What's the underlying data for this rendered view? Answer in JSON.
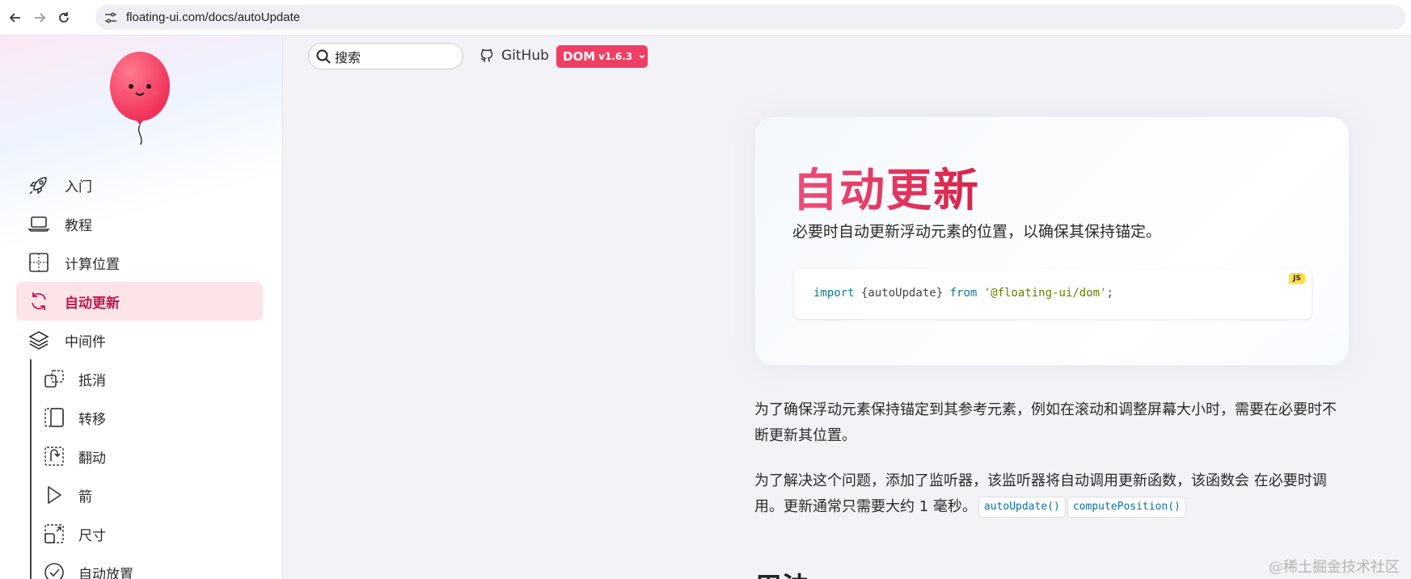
{
  "browser": {
    "url": "floating-ui.com/docs/autoUpdate"
  },
  "sidebar": {
    "items": [
      {
        "label": "入门",
        "icon": "rocket-icon"
      },
      {
        "label": "教程",
        "icon": "laptop-icon"
      },
      {
        "label": "计算位置",
        "icon": "grid-position-icon"
      },
      {
        "label": "自动更新",
        "icon": "refresh-icon",
        "active": true
      },
      {
        "label": "中间件",
        "icon": "layers-icon"
      }
    ],
    "sub_items": [
      {
        "label": "抵消",
        "icon": "offset-icon"
      },
      {
        "label": "转移",
        "icon": "shift-icon"
      },
      {
        "label": "翻动",
        "icon": "flip-icon"
      },
      {
        "label": "箭",
        "icon": "arrow-icon"
      },
      {
        "label": "尺寸",
        "icon": "size-icon"
      },
      {
        "label": "自动放置",
        "icon": "auto-placement-icon"
      }
    ]
  },
  "toolbar": {
    "search_placeholder": "搜索",
    "github_label": "GitHub",
    "version_label": "DOM",
    "version_number": "v1.6.3"
  },
  "hero": {
    "title": "自动更新",
    "subtitle": "必要时自动更新浮动元素的位置，以确保其保持锚定。",
    "code_badge": "JS",
    "code": {
      "kw_import": "import",
      "brace_text": " {autoUpdate} ",
      "kw_from": "from",
      "module": "'@floating-ui/dom'",
      "semicolon": ";"
    }
  },
  "content": {
    "p1": "为了确保浮动元素保持锚定到其参考元素，例如在滚动和调整屏幕大小时，需要在必要时不断更新其位置。",
    "p2_text": "为了解决这个问题，添加了监听器，该监听器将自动调用更新函数，该函数会 在必要时调用。更新通常只需要大约 1 毫秒。",
    "code_auto_update": "autoUpdate()",
    "code_compute_position": "computePosition()",
    "heading_usage": "用法"
  },
  "watermark": "@稀土掘金技术社区",
  "colors": {
    "accent": "#ef3e64",
    "active_bg": "#fde4e9",
    "active_text": "#c2184b"
  }
}
